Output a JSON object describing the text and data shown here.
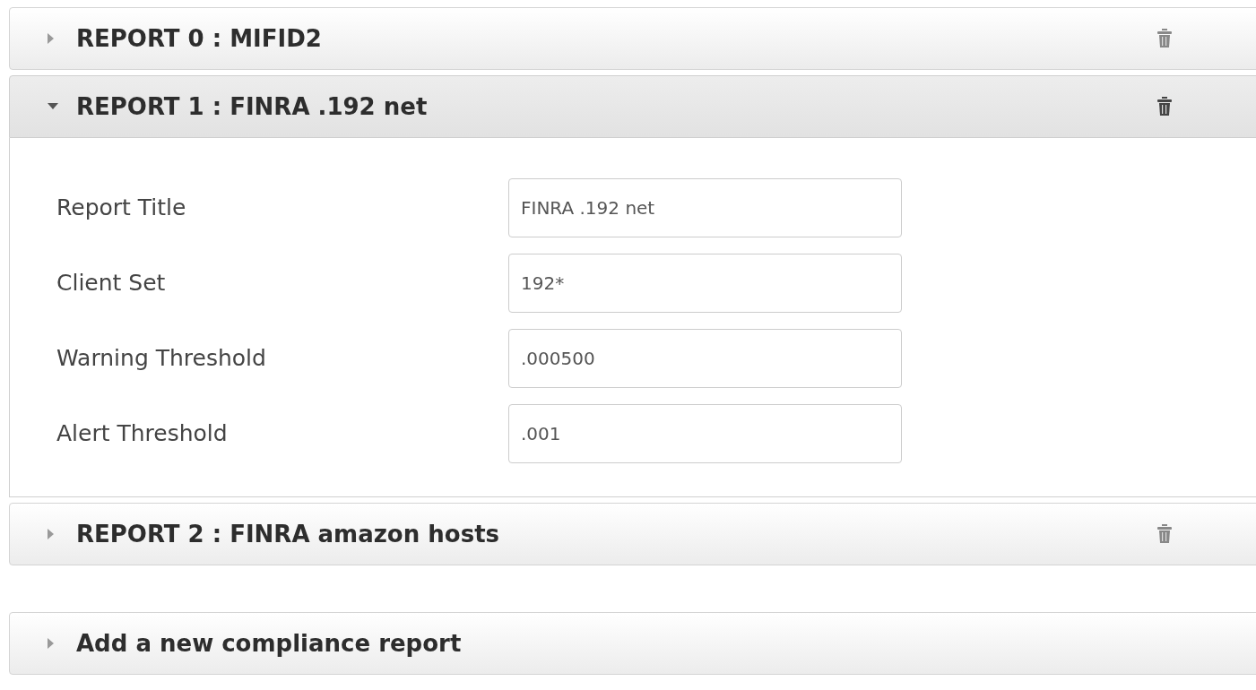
{
  "reports": [
    {
      "title": "REPORT 0 : MIFID2",
      "expanded": false
    },
    {
      "title": "REPORT 1 : FINRA .192 net",
      "expanded": true,
      "fields": [
        {
          "label": "Report Title",
          "value": "FINRA .192 net"
        },
        {
          "label": "Client Set",
          "value": "192*"
        },
        {
          "label": "Warning Threshold",
          "value": ".000500"
        },
        {
          "label": "Alert Threshold",
          "value": ".001"
        }
      ]
    },
    {
      "title": "REPORT 2 : FINRA amazon hosts",
      "expanded": false
    }
  ],
  "add_report": {
    "title": "Add a new compliance report",
    "expanded": false
  }
}
